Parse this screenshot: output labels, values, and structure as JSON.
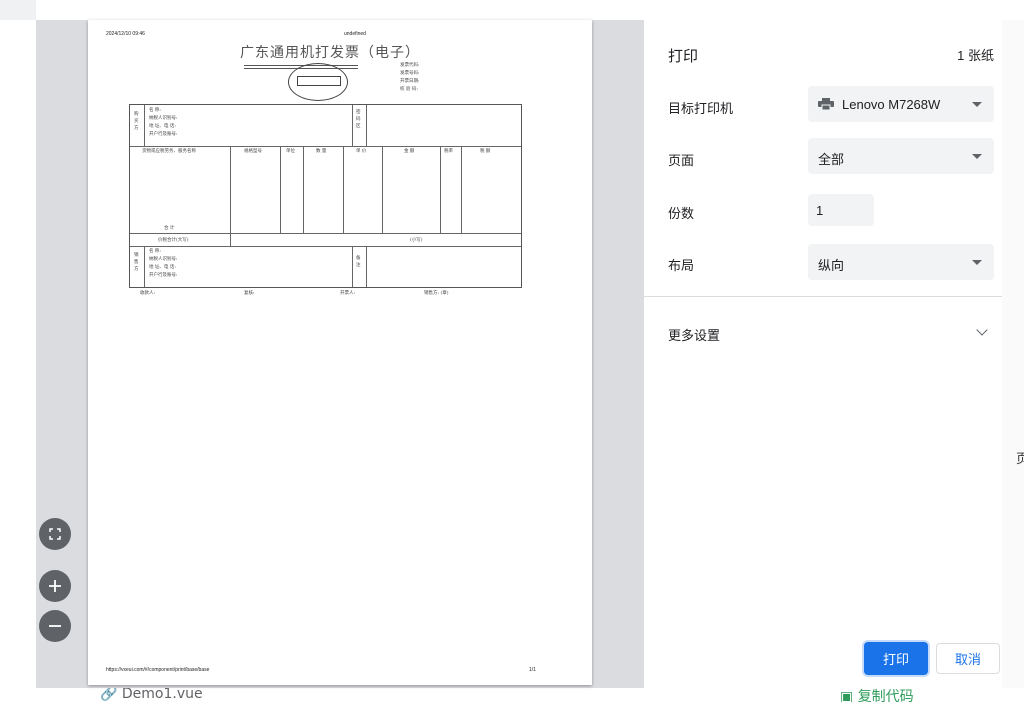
{
  "background": {
    "file_name": "Demo1.vue",
    "copy_link": "复制代码",
    "right_glyph": "页"
  },
  "preview": {
    "header_date": "2024/12/10 09:46",
    "header_title": "undefined",
    "footer_url": "https://vxeui.com/#/component/print/base/base",
    "footer_page": "1/1",
    "invoice": {
      "title": "广东通用机打发票（电子）",
      "meta": [
        "发票代码:",
        "发票号码:",
        "开票日期:",
        "校 验 码:"
      ],
      "buyer_label": "购 买 方",
      "buyer_fields": [
        "名    称:",
        "纳税人识别号:",
        "地 址、电 话:",
        "开户行及账号:"
      ],
      "password_label": "密 码 区",
      "columns": [
        "货物或应税劳务、服务名称",
        "规格型号",
        "单位",
        "数 量",
        "单 价",
        "金 额",
        "税率",
        "税 额"
      ],
      "total_label": "合    计",
      "tax_total_label": "价税合计(大写)",
      "tax_total_small": "(小写)",
      "seller_label": "销 售 方",
      "seller_fields": [
        "名    称:",
        "纳税人识别号:",
        "地 址、电 话:",
        "开户行及账号:"
      ],
      "remark_label": "备 注",
      "signers": [
        "收款人:",
        "复核:",
        "开票人:",
        "销售方: (章)"
      ]
    }
  },
  "zoom": {
    "fit_icon": "fit-to-page-icon",
    "zoom_in_icon": "zoom-in-icon",
    "zoom_out_icon": "zoom-out-icon"
  },
  "panel": {
    "title": "打印",
    "sheet_count": "1 张纸",
    "destination_label": "目标打印机",
    "destination_value": "Lenovo M7268W",
    "pages_label": "页面",
    "pages_value": "全部",
    "copies_label": "份数",
    "copies_value": "1",
    "layout_label": "布局",
    "layout_value": "纵向",
    "more_settings": "更多设置",
    "print_button": "打印",
    "cancel_button": "取消",
    "accent_color": "#1a73e8"
  }
}
